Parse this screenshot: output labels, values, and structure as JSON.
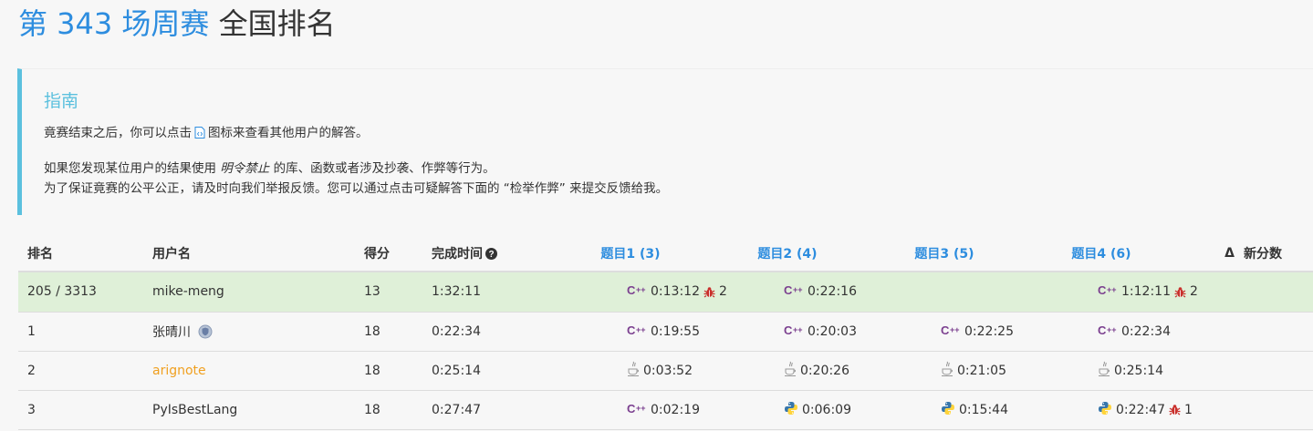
{
  "header": {
    "contest": "第 343 场周赛",
    "rest": "全国排名"
  },
  "guide": {
    "title": "指南",
    "p1_before": "竟赛结束之后，你可以点击",
    "p1_after": "图标来查看其他用户的解答。",
    "p2_before": "如果您发现某位用户的结果使用",
    "p2_em": "明令禁止",
    "p2_after": "的库、函数或者涉及抄袭、作弊等行为。",
    "p3": "为了保证竟赛的公平公正，请及时向我们举报反馈。您可以通过点击可疑解答下面的 “检举作弊” 来提交反馈给我。"
  },
  "table": {
    "headers": {
      "rank": "排名",
      "user": "用户名",
      "score": "得分",
      "time": "完成时间",
      "q1": "题目1 (3)",
      "q2": "题目2 (4)",
      "q3": "题目3 (5)",
      "q4": "题目4 (6)",
      "delta": "Δ",
      "newscore": "新分数"
    },
    "rows": [
      {
        "rank": "205 / 3313",
        "user": "mike-meng",
        "score": "13",
        "time": "1:32:11",
        "q1": {
          "lang": "cpp",
          "time": "0:13:12",
          "bugs": "2"
        },
        "q2": {
          "lang": "cpp",
          "time": "0:22:16",
          "bugs": ""
        },
        "q3": null,
        "q4": {
          "lang": "cpp",
          "time": "1:12:11",
          "bugs": "2"
        }
      },
      {
        "rank": "1",
        "user": "张晴川",
        "score": "18",
        "time": "0:22:34",
        "q1": {
          "lang": "cpp",
          "time": "0:19:55",
          "bugs": ""
        },
        "q2": {
          "lang": "cpp",
          "time": "0:20:03",
          "bugs": ""
        },
        "q3": {
          "lang": "cpp",
          "time": "0:22:25",
          "bugs": ""
        },
        "q4": {
          "lang": "cpp",
          "time": "0:22:34",
          "bugs": ""
        }
      },
      {
        "rank": "2",
        "user": "arignote",
        "score": "18",
        "time": "0:25:14",
        "q1": {
          "lang": "java",
          "time": "0:03:52",
          "bugs": ""
        },
        "q2": {
          "lang": "java",
          "time": "0:20:26",
          "bugs": ""
        },
        "q3": {
          "lang": "java",
          "time": "0:21:05",
          "bugs": ""
        },
        "q4": {
          "lang": "java",
          "time": "0:25:14",
          "bugs": ""
        }
      },
      {
        "rank": "3",
        "user": "PyIsBestLang",
        "score": "18",
        "time": "0:27:47",
        "q1": {
          "lang": "cpp",
          "time": "0:02:19",
          "bugs": ""
        },
        "q2": {
          "lang": "python",
          "time": "0:06:09",
          "bugs": ""
        },
        "q3": {
          "lang": "python",
          "time": "0:15:44",
          "bugs": ""
        },
        "q4": {
          "lang": "python",
          "time": "0:22:47",
          "bugs": "1"
        }
      }
    ]
  },
  "colors": {
    "accent": "#2d8ddf",
    "guide": "#5bc0de",
    "selfRow": "#dff0d8",
    "cpp": "#7b3f8f",
    "bug": "#c9302c",
    "orangeUser": "#f0a020"
  },
  "icons": {
    "solution": "document-code-icon",
    "help": "question-circle-icon",
    "badge": "shield-badge-icon",
    "cpp": "cpp-lang-icon",
    "java": "java-lang-icon",
    "python": "python-lang-icon",
    "bug": "bug-icon"
  }
}
